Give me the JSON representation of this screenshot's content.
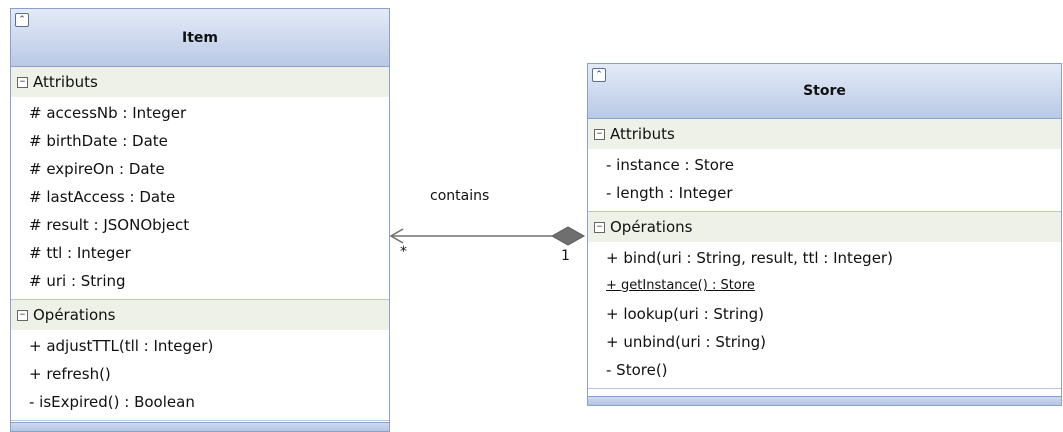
{
  "classes": {
    "item": {
      "name": "Item",
      "attributes_title": "Attributs",
      "attributes": [
        "# accessNb : Integer",
        "# birthDate : Date",
        "# expireOn : Date",
        "# lastAccess : Date",
        "# result : JSONObject",
        "# ttl : Integer",
        "# uri : String"
      ],
      "operations_title": "Opérations",
      "operations": [
        "+ adjustTTL(tll : Integer)",
        "+ refresh()",
        "- isExpired() : Boolean"
      ]
    },
    "store": {
      "name": "Store",
      "attributes_title": "Attributs",
      "attributes": [
        "- instance : Store",
        "- length : Integer"
      ],
      "operations_title": "Opérations",
      "operations": [
        "+ bind(uri : String, result, ttl : Integer)",
        "+ getInstance() : Store",
        "+ lookup(uri : String)",
        "+ unbind(uri : String)",
        "- Store()"
      ]
    }
  },
  "association": {
    "label": "contains",
    "item_multiplicity": "*",
    "store_multiplicity": "1",
    "type": "composition"
  },
  "icons": {
    "collapse": "double-chevron-up-icon",
    "toggle": "minus-box-icon"
  },
  "colors": {
    "header_top": "#e4ebf7",
    "header_bottom": "#b9c9e6",
    "border": "#8aa2c8",
    "section_header": "#eef1e8"
  }
}
